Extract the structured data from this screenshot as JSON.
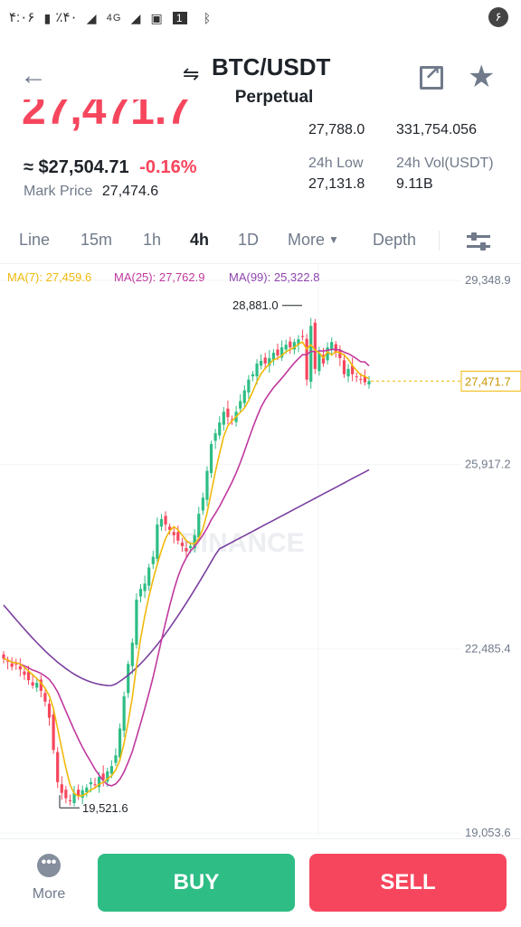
{
  "status_bar": {
    "time": "۴:۰۶",
    "battery": "٪۴۰",
    "network": "4G",
    "sim": "1",
    "notif": "۶"
  },
  "header": {
    "pair": "BTC/USDT",
    "subtitle": "Perpetual",
    "swap_glyph": "⇋",
    "back_glyph": "←",
    "star_glyph": "★"
  },
  "ticker": {
    "last_price": "27,471.7",
    "approx_prefix": "≈",
    "approx_value": "$27,504.71",
    "change": "-0.16%",
    "mark_label": "Mark Price",
    "mark_value": "27,474.6",
    "high_value": "27,788.0",
    "turnover_value": "331,754.056",
    "low_label": "24h Low",
    "low_value": "27,131.8",
    "vol_label": "24h Vol(USDT)",
    "vol_value": "9.11B"
  },
  "tabs": {
    "line": "Line",
    "m15": "15m",
    "h1": "1h",
    "h4": "4h",
    "d1": "1D",
    "more": "More",
    "depth": "Depth",
    "active": "4h"
  },
  "indicators": {
    "ma7": "MA(7): 27,459.6",
    "ma25": "MA(25): 27,762.9",
    "ma99": "MA(99): 25,322.8"
  },
  "colors": {
    "up": "#2ebd85",
    "down": "#f6465d",
    "ma7": "#f0b90b",
    "ma25": "#c0399e",
    "ma99": "#7a3f9f"
  },
  "chart": {
    "watermark": "BINANCE",
    "axis_labels": [
      "29,348.9",
      "25,917.2",
      "22,485.4",
      "19,053.6"
    ],
    "current_price": "27,471.7",
    "high_marker": "28,881.0",
    "low_marker": "19,521.6"
  },
  "chart_data": {
    "type": "candlestick",
    "ylim": [
      19053.6,
      29348.9
    ],
    "y_ticks": [
      29348.9,
      25917.2,
      22485.4,
      19053.6
    ],
    "close": [
      22300,
      22250,
      22150,
      22200,
      22100,
      22000,
      21900,
      21800,
      21850,
      21700,
      21500,
      21200,
      20600,
      20000,
      19800,
      19700,
      19650,
      19800,
      19750,
      19850,
      19900,
      20000,
      19950,
      20100,
      20050,
      20200,
      20300,
      20500,
      21000,
      21600,
      22200,
      22600,
      23400,
      23600,
      23700,
      24000,
      24200,
      24800,
      24900,
      24800,
      24700,
      24600,
      24500,
      24400,
      24300,
      24400,
      24600,
      25000,
      25300,
      25800,
      26300,
      26500,
      26700,
      26900,
      26800,
      26750,
      26900,
      27100,
      27300,
      27500,
      27600,
      27800,
      27850,
      27800,
      27900,
      28000,
      27950,
      28100,
      28150,
      28100,
      28200,
      28250,
      28300,
      27500,
      28500,
      27700,
      28000,
      27800,
      28100,
      28200,
      28000,
      27900,
      27600,
      27700,
      27600,
      27550,
      27500,
      27450,
      27471.7
    ],
    "ma_series": [
      {
        "name": "MA(7)",
        "last": 27459.6
      },
      {
        "name": "MA(25)",
        "last": 27762.9
      },
      {
        "name": "MA(99)",
        "last": 25322.8
      }
    ],
    "annotations": {
      "high": 28881.0,
      "low": 19521.6,
      "current": 27471.7
    }
  },
  "footer": {
    "more": "More",
    "dots": "•••",
    "buy": "BUY",
    "sell": "SELL"
  }
}
